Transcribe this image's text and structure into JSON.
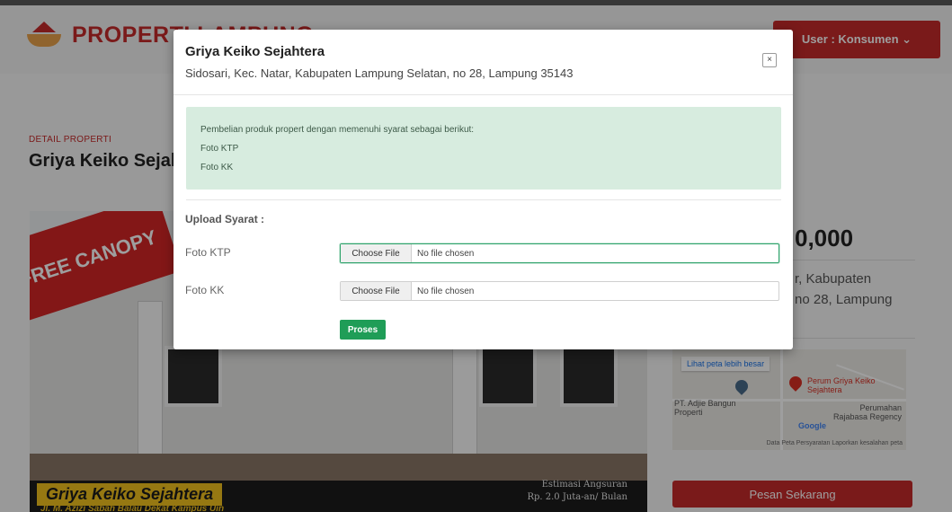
{
  "header": {
    "brand": "PROPERTI LAMPUNG",
    "user_menu": "User : Konsumen ⌄"
  },
  "detail": {
    "eyebrow": "DETAIL PROPERTI",
    "title": "Griya Keiko Sejahtera",
    "price": "0,000",
    "address_lines": [
      "r, Kabupaten",
      "no 28, Lampung"
    ],
    "hero": {
      "badge": "FREE CANOPY",
      "banner_name": "Griya Keiko Sejahtera",
      "banner_sub": "Jl. M. Azizi Sabah Balau Dekat Kampus Uin",
      "estimate_line1": "Estimasi Angsuran",
      "estimate_line2": "Rp. 2.0 Juta-an/ Bulan"
    },
    "map": {
      "link": "Lihat peta lebih besar",
      "place_main": "Perum Griya Keiko Sejahtera",
      "place_2": "PT. Adjie Bangun Properti",
      "place_3": "Perumahan Rajabasa Regency",
      "brand": "Google",
      "footer": "Data Peta   Persyaratan   Laporkan kesalahan peta"
    },
    "order_button": "Pesan Sekarang"
  },
  "modal": {
    "title": "Griya Keiko Sejahtera",
    "subtitle": "Sidosari, Kec. Natar, Kabupaten Lampung Selatan, no 28, Lampung 35143",
    "close": "×",
    "notice": {
      "intro": "Pembelian produk propert dengan memenuhi syarat sebagai berikut:",
      "items": [
        "Foto KTP",
        "Foto KK"
      ]
    },
    "upload_heading": "Upload Syarat :",
    "fields": [
      {
        "label": "Foto KTP",
        "button": "Choose File",
        "status": "No file chosen"
      },
      {
        "label": "Foto KK",
        "button": "Choose File",
        "status": "No file chosen"
      }
    ],
    "submit": "Proses"
  },
  "colors": {
    "brand_red": "#c62a2a",
    "notice_bg": "#d7ecdf",
    "submit_green": "#1f9d57",
    "focus_green": "#2fa36b"
  }
}
